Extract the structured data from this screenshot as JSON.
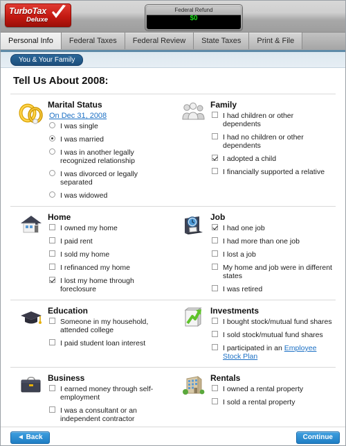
{
  "header": {
    "logo_main": "TurboTax",
    "logo_sub": "Deluxe",
    "logo_check_icon": "checkmark-icon",
    "refund_label": "Federal Refund",
    "refund_amount": "$0",
    "refund_amount_color": "#19e019"
  },
  "tabs": [
    {
      "label": "Personal Info",
      "active": true
    },
    {
      "label": "Federal Taxes",
      "active": false
    },
    {
      "label": "Federal Review",
      "active": false
    },
    {
      "label": "State Taxes",
      "active": false
    },
    {
      "label": "Print & File",
      "active": false
    }
  ],
  "breadcrumb": "You & Your Family",
  "page_title": "Tell Us About 2008:",
  "accent_link_color": "#1a6fc4",
  "sections": {
    "marital": {
      "title": "Marital Status",
      "icon": "wedding-rings-icon",
      "link": "On Dec 31, 2008",
      "options": [
        {
          "label": "I was single",
          "checked": false
        },
        {
          "label": "I was married",
          "checked": true
        },
        {
          "label": "I was in another legally recognized relationship",
          "checked": false
        },
        {
          "label": "I was divorced or legally separated",
          "checked": false
        },
        {
          "label": "I was widowed",
          "checked": false
        }
      ]
    },
    "family": {
      "title": "Family",
      "icon": "family-group-icon",
      "options": [
        {
          "label": "I had children or other dependents",
          "checked": false
        },
        {
          "label": "I had no children or other dependents",
          "checked": false
        },
        {
          "label": "I adopted a child",
          "checked": true
        },
        {
          "label": "I financially supported a relative",
          "checked": false
        }
      ]
    },
    "home": {
      "title": "Home",
      "icon": "house-icon",
      "options": [
        {
          "label": "I owned my home",
          "checked": false
        },
        {
          "label": "I paid rent",
          "checked": false
        },
        {
          "label": "I sold my home",
          "checked": false
        },
        {
          "label": "I refinanced my home",
          "checked": false
        },
        {
          "label": "I lost my home through foreclosure",
          "checked": true
        }
      ]
    },
    "job": {
      "title": "Job",
      "icon": "time-clock-icon",
      "options": [
        {
          "label": "I had one job",
          "checked": true
        },
        {
          "label": "I had more than one job",
          "checked": false
        },
        {
          "label": "I lost a job",
          "checked": false
        },
        {
          "label": "My home and job were in different states",
          "checked": false
        },
        {
          "label": "I was retired",
          "checked": false
        }
      ]
    },
    "education": {
      "title": "Education",
      "icon": "graduation-cap-icon",
      "options": [
        {
          "label": "Someone in my household, attended college",
          "checked": false
        },
        {
          "label": "I paid student loan interest",
          "checked": false
        }
      ]
    },
    "investments": {
      "title": "Investments",
      "icon": "chart-up-arrow-icon",
      "options": [
        {
          "label": "I bought stock/mutual fund shares",
          "checked": false
        },
        {
          "label": "I sold stock/mutual fund shares",
          "checked": false
        },
        {
          "label": "I participated in an ",
          "checked": false,
          "link": "Employee Stock Plan"
        }
      ]
    },
    "business": {
      "title": "Business",
      "icon": "briefcase-icon",
      "options": [
        {
          "label": "I earned money through self-employment",
          "checked": false
        },
        {
          "label": "I was a consultant or an independent contractor",
          "checked": false
        }
      ]
    },
    "rentals": {
      "title": "Rentals",
      "icon": "apartment-building-icon",
      "options": [
        {
          "label": "I owned a rental property",
          "checked": false
        },
        {
          "label": "I sold a rental property",
          "checked": false
        }
      ]
    }
  },
  "footer": {
    "back_label": "◄ Back",
    "continue_label": "Continue"
  }
}
